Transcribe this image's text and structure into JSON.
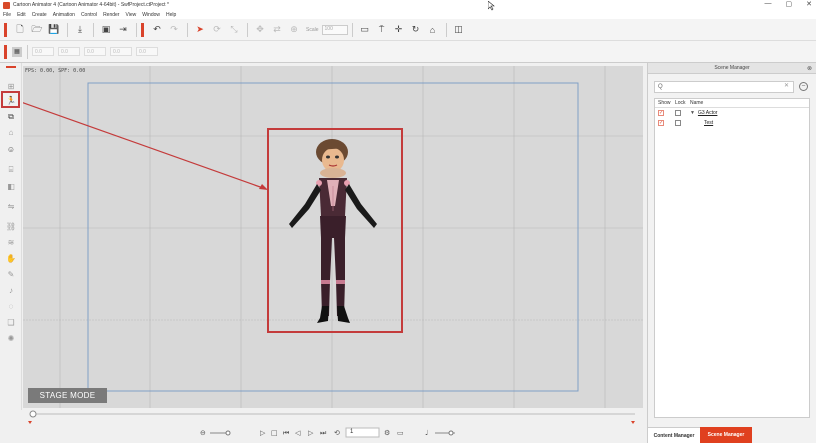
{
  "window": {
    "title": "Cartoon Animator 4 (Cartoon Animator 4-64bit) - SwfProject.ctProject *",
    "buttons": [
      "—",
      "▢",
      "✕"
    ]
  },
  "menu": [
    "File",
    "Edit",
    "Create",
    "Animation",
    "Control",
    "Render",
    "View",
    "Window",
    "Help"
  ],
  "toolbar": {
    "scale_label": "Scale",
    "scale_value": "100"
  },
  "toolbar2_fields": [
    "0.0",
    "0.0",
    "0.0",
    "0.0",
    "0.0"
  ],
  "viewport": {
    "fps_text": "FPS: 0.00, SPF: 0.00",
    "stage_mode_label": "STAGE MODE"
  },
  "timeline": {
    "frame_value": "1"
  },
  "scene_manager": {
    "title": "Scene Manager",
    "search_value": "Q",
    "columns": {
      "show": "Show",
      "lock": "Lock",
      "name": "Name"
    },
    "rows": [
      {
        "name": "G3 Actor",
        "show": true,
        "lock": false,
        "expandable": true
      },
      {
        "name": "Test",
        "show": true,
        "lock": false,
        "expandable": false
      }
    ],
    "tabs": {
      "content": "Content Manager",
      "scene": "Scene Manager"
    }
  },
  "colors": {
    "accent": "#d9432b",
    "highlight_box": "#c43b3b",
    "stage_bg": "#d8d8d8",
    "stage_frame": "#7f9fc6"
  }
}
